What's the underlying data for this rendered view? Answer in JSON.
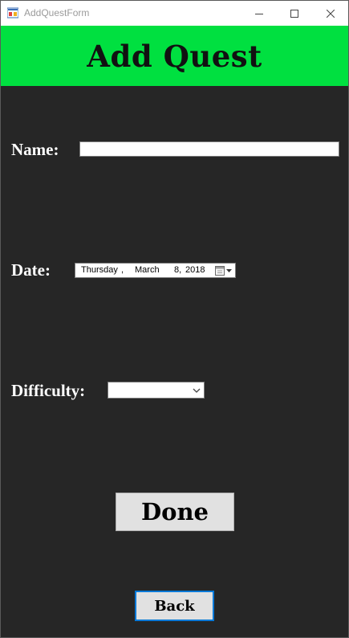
{
  "window": {
    "title": "AddQuestForm",
    "minimize_icon": "minimize-icon",
    "maximize_icon": "maximize-icon",
    "close_icon": "close-icon"
  },
  "header": {
    "title": "Add Quest",
    "background": "#00e040"
  },
  "form": {
    "name_label": "Name:",
    "name_value": "",
    "date_label": "Date:",
    "date": {
      "weekday": "Thursday",
      "comma1": ",",
      "month": "March",
      "day": "8,",
      "year": "2018",
      "calendar_icon": "calendar-icon"
    },
    "difficulty_label": "Difficulty:",
    "difficulty_value": "",
    "dropdown_icon": "chevron-down-icon"
  },
  "buttons": {
    "done_label": "Done",
    "back_label": "Back"
  },
  "colors": {
    "body_background": "#262626",
    "header_green": "#00e040",
    "focus_border": "#0078d7"
  }
}
